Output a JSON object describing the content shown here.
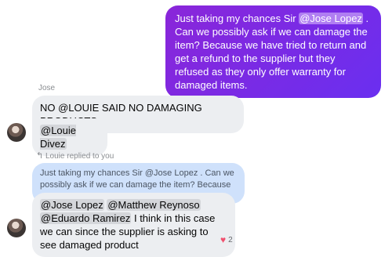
{
  "messages": {
    "outgoing": {
      "text_before": "Just taking my chances Sir ",
      "mention": "@Jose Lopez",
      "text_after": " . Can we possibly ask if we can damage the item? Because we have tried to return and get a refund to the supplier but they refused as they only offer warranty for damaged items."
    },
    "jose": {
      "sender": "Jose",
      "message1": "NO @LOUIE SAID NO DAMAGING PRODUCTS.",
      "message2_mention": "@Louie Divez"
    },
    "reply": {
      "replied_label": "Louie replied to you",
      "quote_text": "Just taking my chances Sir @Jose Lopez . Can we possibly ask if we can damage the item? Because we...",
      "mention1": "@Jose Lopez",
      "mention2": "@Matthew Reynoso",
      "mention3": "@Eduardo Ramirez",
      "text_after": " I think in this case we can since the supplier is asking to see damaged product",
      "reaction_count": "2"
    }
  },
  "icons": {
    "reply": "reply-arrow-icon",
    "reaction": "heart-icon"
  },
  "colors": {
    "outgoing_bubble": "#7b1fe4",
    "incoming_bubble": "#eceef1",
    "quote_bubble": "#cfe1fb",
    "heart": "#f0506e"
  }
}
